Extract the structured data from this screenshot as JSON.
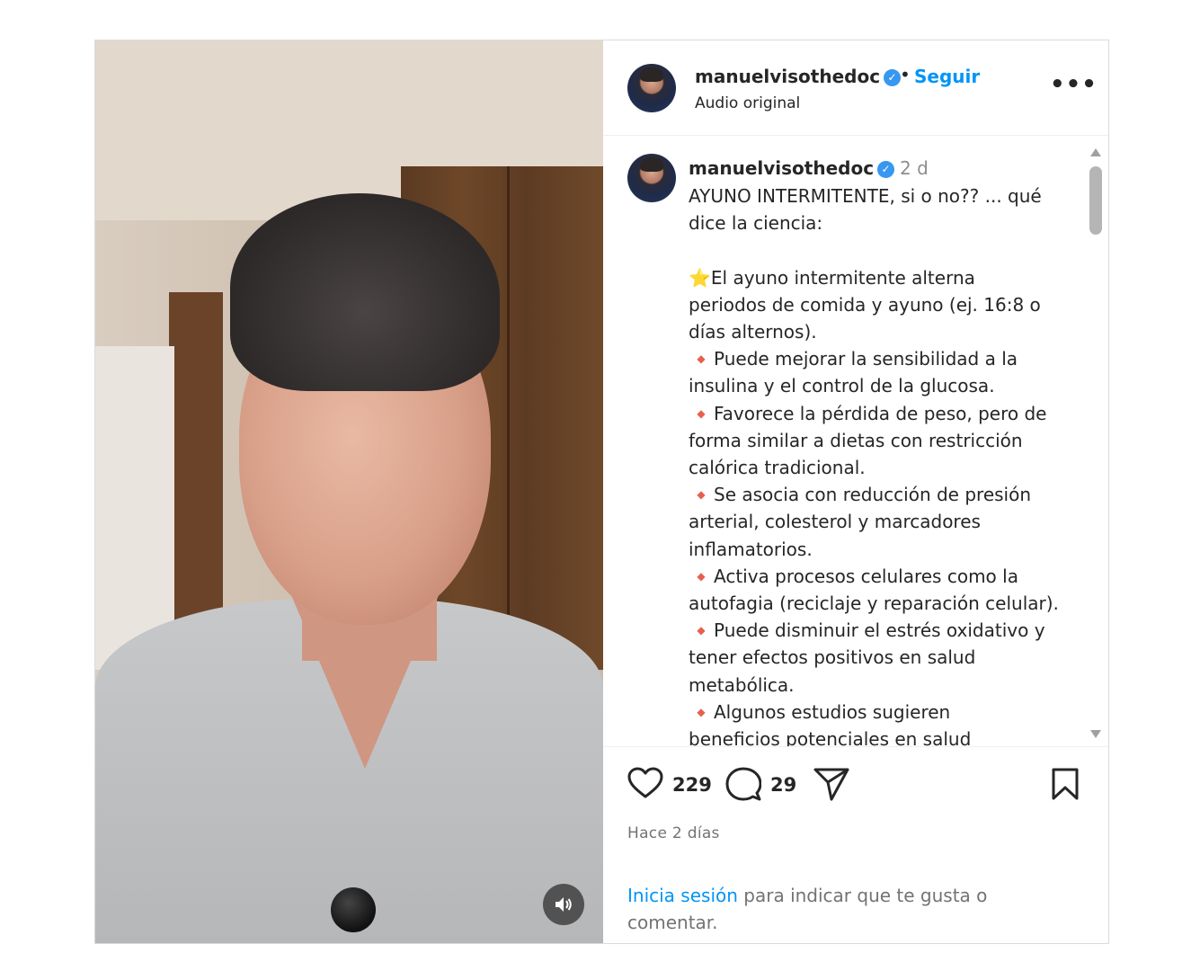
{
  "header": {
    "username": "manuelvisothedoc",
    "separator": "•",
    "follow_label": "Seguir",
    "subtitle": "Audio original",
    "more_label": "•••"
  },
  "caption": {
    "username": "manuelvisothedoc",
    "time": "2 d",
    "lines": [
      "AYUNO INTERMITENTE, si o no?? ... qué",
      "dice la ciencia:",
      "",
      "El ayuno intermitente alterna",
      "periodos de comida y ayuno (ej. 16:8 o",
      "días alternos).",
      "Puede mejorar la sensibilidad a la",
      "insulina y el control de la glucosa.",
      "Favorece la pérdida de peso, pero de",
      "forma similar a dietas con restricción",
      "calórica tradicional.",
      "Se asocia con reducción de presión",
      "arterial, colesterol y marcadores",
      "inflamatorios.",
      "Activa procesos celulares como la",
      "autofagia (reciclaje y reparación celular).",
      "Puede disminuir el estrés oxidativo y",
      "tener efectos positivos en salud",
      "metabólica.",
      "Algunos estudios sugieren",
      "beneficios potenciales en salud"
    ]
  },
  "actions": {
    "likes": "229",
    "comments": "29",
    "time_ago": "Hace 2 días"
  },
  "login": {
    "link": "Inicia sesión",
    "rest": " para indicar que te gusta o",
    "rest2": "comentar."
  },
  "colors": {
    "accent": "#0095f6",
    "verified": "#3897f0",
    "bullet": "#e8604c",
    "star": "#f4b400"
  },
  "icons": {
    "mute": "speaker-icon",
    "like": "heart-icon",
    "comment": "comment-bubble-icon",
    "share": "paper-plane-icon",
    "save": "bookmark-icon"
  }
}
